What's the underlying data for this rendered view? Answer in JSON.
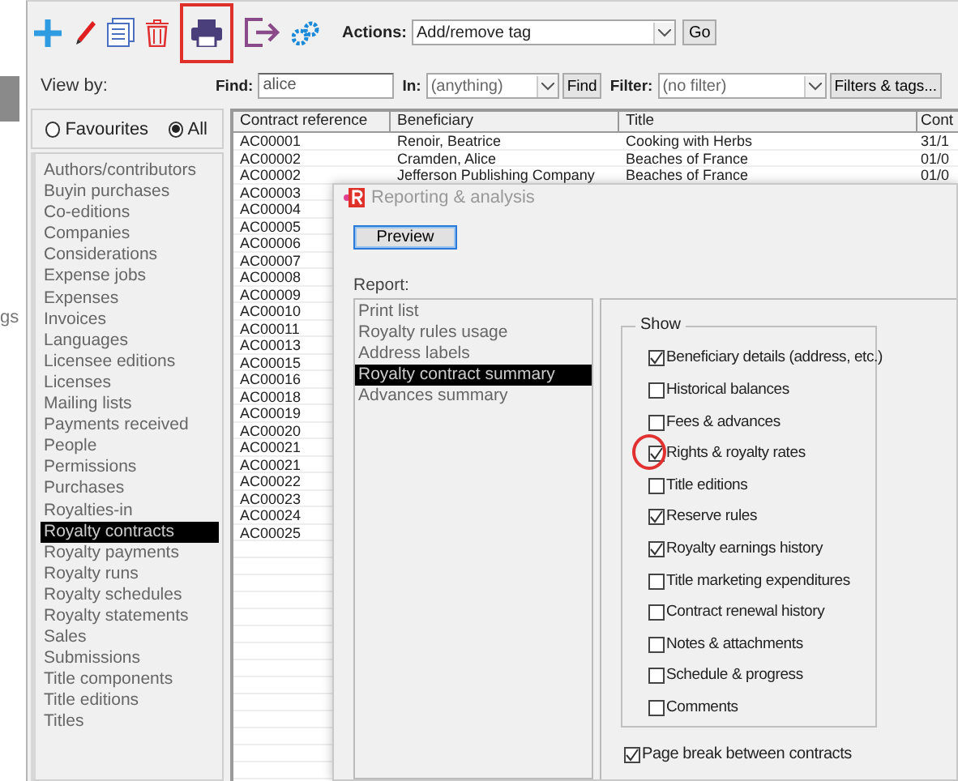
{
  "background_text": "gs",
  "toolbar": {
    "tools": [
      {
        "kind": "add",
        "highlighted": false
      },
      {
        "kind": "edit",
        "highlighted": false
      },
      {
        "kind": "copy",
        "highlighted": false
      },
      {
        "kind": "delete",
        "highlighted": false
      },
      {
        "kind": "print",
        "highlighted": true
      },
      {
        "kind": "exit",
        "highlighted": false
      },
      {
        "kind": "settings",
        "highlighted": false
      }
    ],
    "actions_label": "Actions:",
    "actions_value": "Add/remove tag",
    "go_button": "Go"
  },
  "find_bar": {
    "find_label": "Find:",
    "find_value": "alice",
    "in_label": "In:",
    "in_value": "(anything)",
    "find_button": "Find",
    "filter_label": "Filter:",
    "filter_value": "(no filter)",
    "filters_button": "Filters & tags..."
  },
  "view_by": {
    "label": "View by:",
    "options": [
      {
        "label": "Favourites",
        "selected": false
      },
      {
        "label": "All",
        "selected": true
      }
    ],
    "items": [
      {
        "label": "Authors/contributors",
        "selected": false
      },
      {
        "label": "Buyin purchases",
        "selected": false
      },
      {
        "label": "Co-editions",
        "selected": false
      },
      {
        "label": "Companies",
        "selected": false
      },
      {
        "label": "Considerations",
        "selected": false
      },
      {
        "label": "Expense jobs",
        "selected": false
      },
      {
        "label": "Expenses",
        "selected": false
      },
      {
        "label": "Invoices",
        "selected": false
      },
      {
        "label": "Languages",
        "selected": false
      },
      {
        "label": "Licensee editions",
        "selected": false
      },
      {
        "label": "Licenses",
        "selected": false
      },
      {
        "label": "Mailing lists",
        "selected": false
      },
      {
        "label": "Payments received",
        "selected": false
      },
      {
        "label": "People",
        "selected": false
      },
      {
        "label": "Permissions",
        "selected": false
      },
      {
        "label": "Purchases",
        "selected": false
      },
      {
        "label": "Royalties-in",
        "selected": false
      },
      {
        "label": "Royalty contracts",
        "selected": true
      },
      {
        "label": "Royalty payments",
        "selected": false
      },
      {
        "label": "Royalty runs",
        "selected": false
      },
      {
        "label": "Royalty schedules",
        "selected": false
      },
      {
        "label": "Royalty statements",
        "selected": false
      },
      {
        "label": "Sales",
        "selected": false
      },
      {
        "label": "Submissions",
        "selected": false
      },
      {
        "label": "Title components",
        "selected": false
      },
      {
        "label": "Title editions",
        "selected": false
      },
      {
        "label": "Titles",
        "selected": false
      }
    ]
  },
  "table": {
    "columns": [
      "Contract reference",
      "Beneficiary",
      "Title",
      "Cont"
    ],
    "rows": [
      [
        "AC00001",
        "Renoir, Beatrice",
        "Cooking with Herbs",
        "31/1"
      ],
      [
        "AC00002",
        "Cramden, Alice",
        "Beaches of France",
        "01/0"
      ],
      [
        "AC00002",
        "Jefferson Publishing Company",
        "Beaches of France",
        "01/0"
      ],
      [
        "AC00003"
      ],
      [
        "AC00004"
      ],
      [
        "AC00005"
      ],
      [
        "AC00006"
      ],
      [
        "AC00007"
      ],
      [
        "AC00008"
      ],
      [
        "AC00009"
      ],
      [
        "AC00010"
      ],
      [
        "AC00011"
      ],
      [
        "AC00013"
      ],
      [
        "AC00015"
      ],
      [
        "AC00016"
      ],
      [
        "AC00018"
      ],
      [
        "AC00019"
      ],
      [
        "AC00020"
      ],
      [
        "AC00021"
      ],
      [
        "AC00021"
      ],
      [
        "AC00022"
      ],
      [
        "AC00023"
      ],
      [
        "AC00024"
      ],
      [
        "AC00025"
      ]
    ]
  },
  "dialog": {
    "title": "Reporting & analysis",
    "preview_button": "Preview",
    "report_label": "Report:",
    "reports": [
      {
        "label": "Print list",
        "selected": false
      },
      {
        "label": "Royalty rules usage",
        "selected": false
      },
      {
        "label": "Address labels",
        "selected": false
      },
      {
        "label": "Royalty contract summary",
        "selected": true
      },
      {
        "label": "Advances summary",
        "selected": false
      }
    ],
    "show_label": "Show",
    "options": [
      {
        "label": "Beneficiary details (address, etc.)",
        "checked": true,
        "highlighted": false
      },
      {
        "label": "Historical balances",
        "checked": false,
        "highlighted": false
      },
      {
        "label": "Fees & advances",
        "checked": false,
        "highlighted": false
      },
      {
        "label": "Rights & royalty rates",
        "checked": true,
        "highlighted": true
      },
      {
        "label": "Title editions",
        "checked": false,
        "highlighted": false
      },
      {
        "label": "Reserve rules",
        "checked": true,
        "highlighted": false
      },
      {
        "label": "Royalty earnings history",
        "checked": true,
        "highlighted": false
      },
      {
        "label": "Title marketing expenditures",
        "checked": false,
        "highlighted": false
      },
      {
        "label": "Contract renewal history",
        "checked": false,
        "highlighted": false
      },
      {
        "label": "Notes & attachments",
        "checked": false,
        "highlighted": false
      },
      {
        "label": "Schedule & progress",
        "checked": false,
        "highlighted": false
      },
      {
        "label": "Comments",
        "checked": false,
        "highlighted": false
      }
    ],
    "page_break": {
      "label": "Page break between contracts",
      "checked": true
    }
  }
}
